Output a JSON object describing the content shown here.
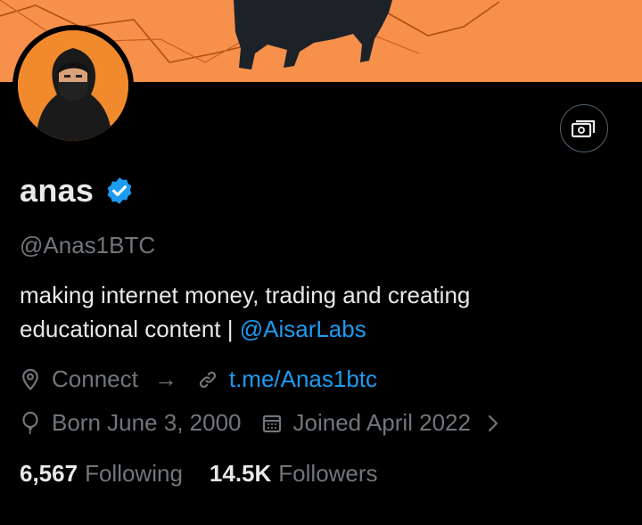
{
  "profile": {
    "name": "anas",
    "handle": "@Anas1BTC",
    "bio_line1": "making internet money, trading and creating",
    "bio_line2_prefix": "educational content | ",
    "bio_mention": "@AisarLabs",
    "location": "Connect",
    "location_arrow": "→",
    "website": "t.me/Anas1btc",
    "birthday": "Born June 3, 2000",
    "joined": "Joined April 2022",
    "following_count": "6,567",
    "following_label": "Following",
    "followers_count": "14.5K",
    "followers_label": "Followers"
  },
  "icons": {
    "verified": "verified-badge-icon",
    "monetize": "money-icon",
    "location": "location-pin-icon",
    "website": "link-icon",
    "birthday": "balloon-icon",
    "joined": "calendar-icon",
    "chevron": "chevron-right-icon"
  },
  "colors": {
    "background": "#000000",
    "banner": "#f6904a",
    "accent": "#1d9bf0",
    "text": "#e7e9ea",
    "muted": "#71767b"
  }
}
